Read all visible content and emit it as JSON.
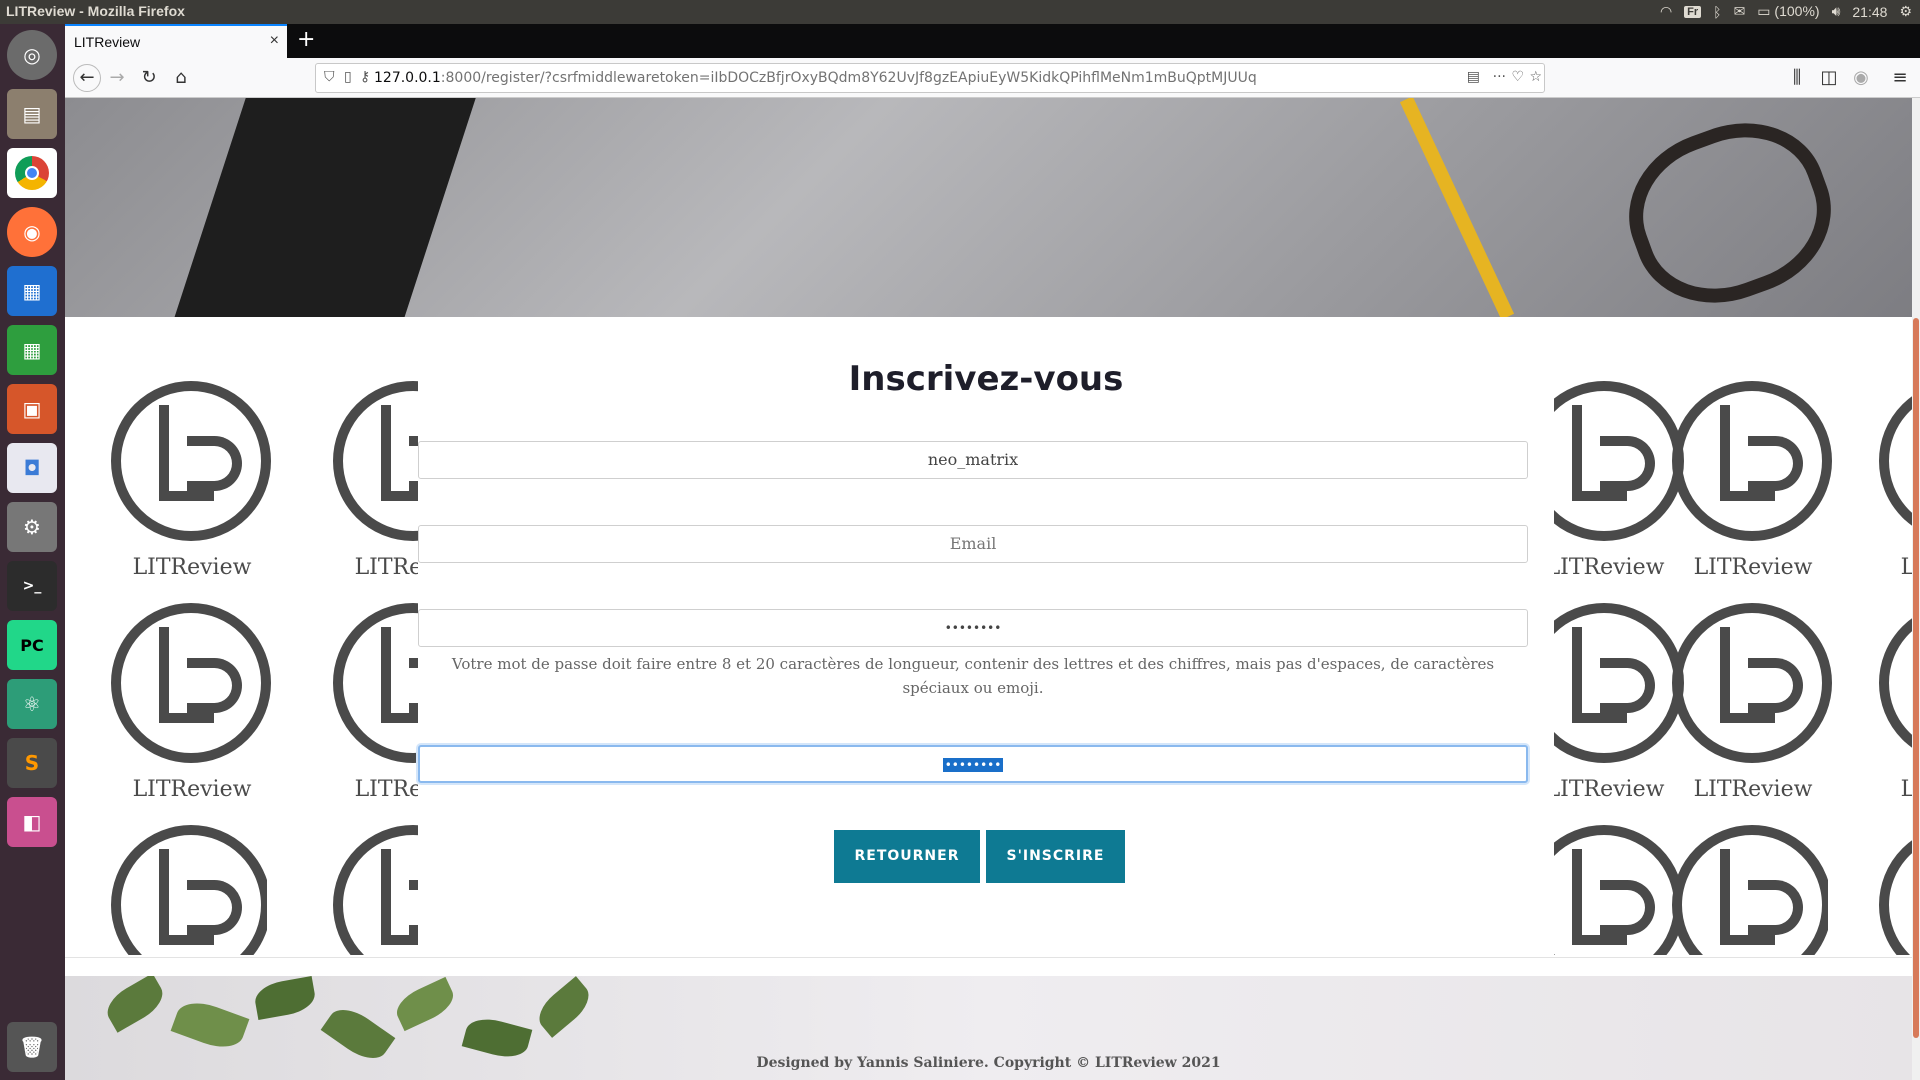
{
  "os": {
    "window_title": "LITReview - Mozilla Firefox",
    "keyboard_layout": "Fr",
    "battery": "(100%)",
    "clock": "21:48"
  },
  "browser": {
    "tab_title": "LITReview",
    "url_host": "127.0.0.1",
    "url_rest": ":8000/register/?csrfmiddlewaretoken=iIbDOCzBfjrOxyBQdm8Y62UvJf8gzEApiuEyW5KidkQPihflMeNm1mBuQptMJUUq"
  },
  "page": {
    "logo_text": "LITReview",
    "heading": "Inscrivez-vous",
    "username_value": "neo_matrix",
    "email_placeholder": "Email",
    "password_value": "••••••••",
    "password_help": "Votre mot de passe doit faire entre 8 et 20 caractères de longueur, contenir des lettres et des chiffres, mais pas d'espaces, de caractères spéciaux ou emoji.",
    "password_confirm_value": "••••••••",
    "back_button": "RETOURNER",
    "submit_button": "S'INSCRIRE",
    "footer": "Designed by Yannis Saliniere. Copyright © LITReview 2021"
  },
  "colors": {
    "accent_button": "#0e7a93",
    "heading": "#1e1e2a",
    "focus_ring": "#8ab9ee"
  }
}
